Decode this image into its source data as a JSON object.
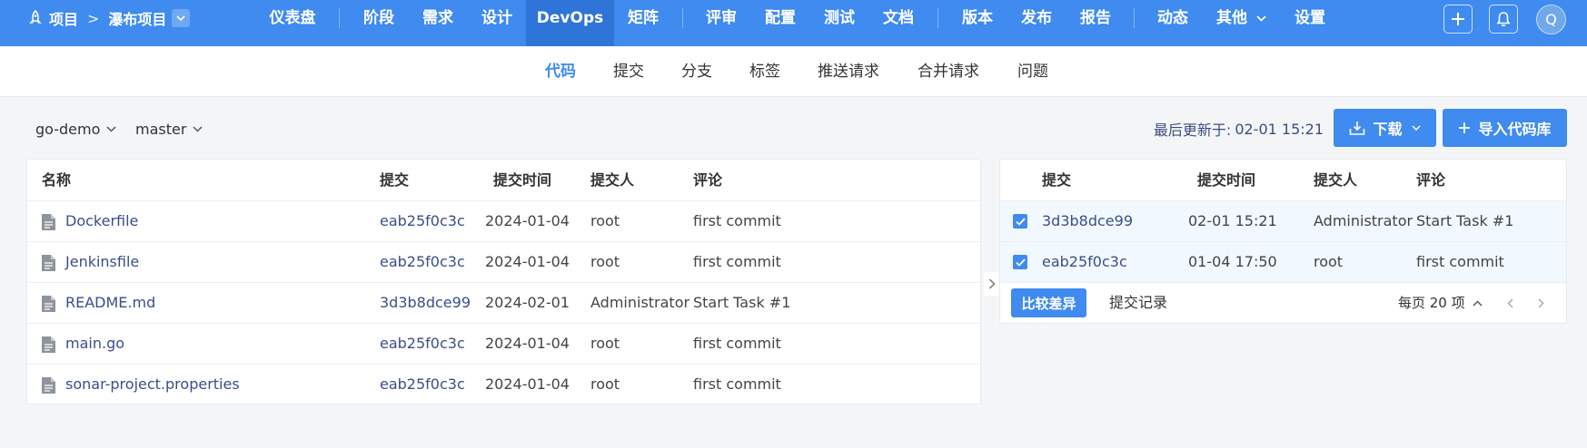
{
  "topbar": {
    "project_label": "项目",
    "separator": ">",
    "project_name": "瀑布项目",
    "nav": [
      "仪表盘",
      "阶段",
      "需求",
      "设计",
      "DevOps",
      "矩阵",
      "评审",
      "配置",
      "测试",
      "文档",
      "版本",
      "发布",
      "报告",
      "动态",
      "其他",
      "设置"
    ],
    "active_nav": "DevOps",
    "avatar_letter": "Q"
  },
  "subnav": {
    "items": [
      "代码",
      "提交",
      "分支",
      "标签",
      "推送请求",
      "合并请求",
      "问题"
    ],
    "active": "代码"
  },
  "toolbar": {
    "repo": "go-demo",
    "branch": "master",
    "updated_label": "最后更新于:",
    "updated_value": "02-01 15:21",
    "download_label": "下载",
    "import_label": "导入代码库"
  },
  "files": {
    "columns": [
      "名称",
      "提交",
      "提交时间",
      "提交人",
      "评论"
    ],
    "rows": [
      {
        "name": "Dockerfile",
        "commit": "eab25f0c3c",
        "time": "2024-01-04",
        "author": "root",
        "comment": "first commit"
      },
      {
        "name": "Jenkinsfile",
        "commit": "eab25f0c3c",
        "time": "2024-01-04",
        "author": "root",
        "comment": "first commit"
      },
      {
        "name": "README.md",
        "commit": "3d3b8dce99",
        "time": "2024-02-01",
        "author": "Administrator",
        "comment": "Start Task #1"
      },
      {
        "name": "main.go",
        "commit": "eab25f0c3c",
        "time": "2024-01-04",
        "author": "root",
        "comment": "first commit"
      },
      {
        "name": "sonar-project.properties",
        "commit": "eab25f0c3c",
        "time": "2024-01-04",
        "author": "root",
        "comment": "first commit"
      }
    ]
  },
  "commits": {
    "columns": [
      "提交",
      "提交时间",
      "提交人",
      "评论"
    ],
    "rows": [
      {
        "commit": "3d3b8dce99",
        "time": "02-01 15:21",
        "author": "Administrator",
        "comment": "Start Task #1",
        "checked": true
      },
      {
        "commit": "eab25f0c3c",
        "time": "01-04 17:50",
        "author": "root",
        "comment": "first commit",
        "checked": true
      }
    ],
    "compare_label": "比较差异",
    "history_label": "提交记录",
    "page_size_label": "每页 20 项"
  },
  "colors": {
    "brand": "#3f8bf0",
    "nav_active": "#2f74d7",
    "link": "#3a4e8c",
    "selected_row": "#f2f8ff"
  },
  "icons": [
    "rocket-icon",
    "chevron-right-icon",
    "chevron-down-icon",
    "plus-icon",
    "bell-icon",
    "download-icon",
    "file-icon",
    "checkbox-checked-icon",
    "chevron-up-icon",
    "chevron-left-icon"
  ]
}
